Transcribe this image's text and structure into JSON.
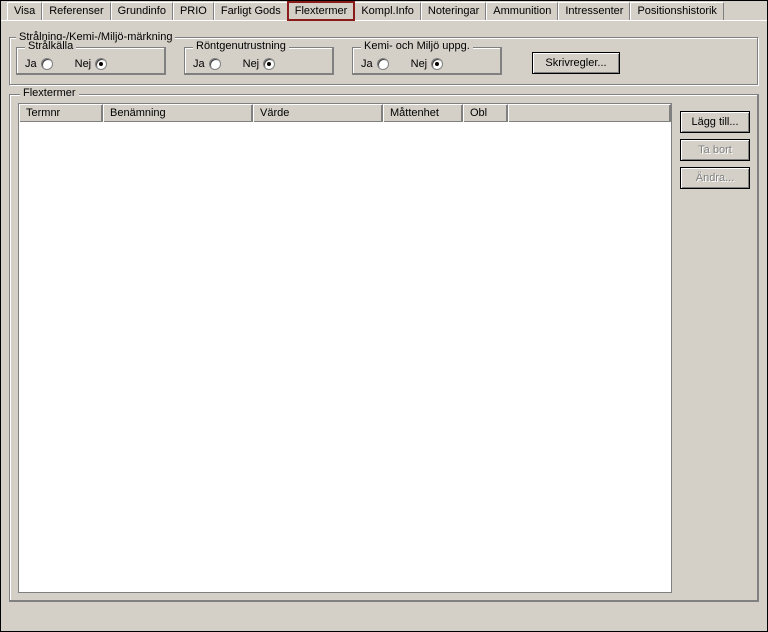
{
  "tabs": [
    {
      "label": "Visa"
    },
    {
      "label": "Referenser"
    },
    {
      "label": "Grundinfo"
    },
    {
      "label": "PRIO"
    },
    {
      "label": "Farligt Gods"
    },
    {
      "label": "Flextermer",
      "active": true
    },
    {
      "label": "Kompl.Info"
    },
    {
      "label": "Noteringar"
    },
    {
      "label": "Ammunition"
    },
    {
      "label": "Intressenter"
    },
    {
      "label": "Positionshistorik"
    }
  ],
  "marking": {
    "group_title": "Strålning-/Kemi-/Miljö-märkning",
    "radio_ja": "Ja",
    "radio_nej": "Nej",
    "groups": {
      "stralkalla": {
        "title": "Strålkälla",
        "selected": "nej"
      },
      "rontgen": {
        "title": "Röntgenutrustning",
        "selected": "nej"
      },
      "kemi": {
        "title": "Kemi- och Miljö uppg.",
        "selected": "nej"
      }
    },
    "skrivregler_label": "Skrivregler..."
  },
  "flextermer": {
    "group_title": "Flextermer",
    "columns": {
      "termnr": "Termnr",
      "benamning": "Benämning",
      "varde": "Värde",
      "mattenhet": "Måttenhet",
      "obl": "Obl"
    },
    "rows": []
  },
  "buttons": {
    "lagg_till": "Lägg till...",
    "ta_bort": "Ta bort",
    "andra": "Ändra..."
  }
}
